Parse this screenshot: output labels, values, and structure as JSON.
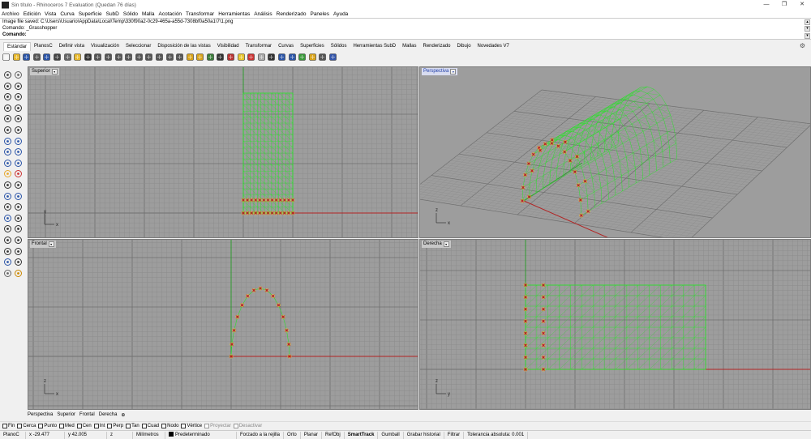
{
  "window": {
    "title": "Sin título - Rhinoceros 7 Evaluation (Quedan 76 días)",
    "min": "—",
    "restore": "❐",
    "close": "✕"
  },
  "menu": [
    "Archivo",
    "Edición",
    "Vista",
    "Curva",
    "Superficie",
    "SubD",
    "Sólido",
    "Malla",
    "Acotación",
    "Transformar",
    "Herramientas",
    "Análisis",
    "Renderizado",
    "Paneles",
    "Ayuda"
  ],
  "command": {
    "history": [
      "Image file saved: C:\\Users\\Usuario\\AppData\\Local\\Temp\\330f90a2-0c29-465a-a55d-7308bf0a50a1\\7\\1.png",
      "Comando: _Grasshopper"
    ],
    "prompt": "Comando:",
    "value": ""
  },
  "tabs": [
    "Estándar",
    "PlanosC",
    "Definir vista",
    "Visualización",
    "Seleccionar",
    "Disposición de las vistas",
    "Visibilidad",
    "Transformar",
    "Curvas",
    "Superficies",
    "Sólidos",
    "Herramientas SubD",
    "Mallas",
    "Renderizado",
    "Dibujo",
    "Novedades V7"
  ],
  "active_tab": "Estándar",
  "toolbar_icons": [
    "new-file-icon",
    "open-file-icon",
    "save-icon",
    "print-icon",
    "import-icon",
    "cut-icon",
    "copy-icon",
    "paste-icon",
    "undo-icon",
    "pan-icon",
    "rotate-view-icon",
    "zoom-window-icon",
    "zoom-dynamic-icon",
    "zoom-extents-icon",
    "zoom-selected-icon",
    "undo-view-icon",
    "four-viewports-icon",
    "select-all-icon",
    "hide-icon",
    "lock-icon",
    "layer-icon",
    "properties-icon",
    "osnap-icon",
    "lights-icon",
    "material-icon",
    "shaded-icon",
    "rendered-icon",
    "render-icon",
    "environment-icon",
    "grasshopper-icon",
    "sun-icon",
    "options-icon",
    "help-icon"
  ],
  "viewports": {
    "top": {
      "label": "Superior",
      "axis_y": "y",
      "axis_x": "x"
    },
    "perspective": {
      "label": "Perspectiva",
      "axis_y": "z",
      "axis_x": "x"
    },
    "front": {
      "label": "Frontal",
      "axis_y": "z",
      "axis_x": "x"
    },
    "right": {
      "label": "Derecha",
      "axis_y": "z",
      "axis_x": "y"
    }
  },
  "viewport_tabs": [
    "Perspectiva",
    "Superior",
    "Frontal",
    "Derecha"
  ],
  "viewport_tabs_add": "⊕",
  "osnaps": [
    {
      "label": "Fin",
      "checked": false
    },
    {
      "label": "Cerca",
      "checked": false
    },
    {
      "label": "Punto",
      "checked": false
    },
    {
      "label": "Med",
      "checked": false
    },
    {
      "label": "Cen",
      "checked": false
    },
    {
      "label": "Int",
      "checked": false
    },
    {
      "label": "Perp",
      "checked": false
    },
    {
      "label": "Tan",
      "checked": false
    },
    {
      "label": "Cuad",
      "checked": false
    },
    {
      "label": "Nodo",
      "checked": false
    },
    {
      "label": "Vértice",
      "checked": false
    },
    {
      "label": "Proyectar",
      "checked": false,
      "disabled": true
    },
    {
      "label": "Desactivar",
      "checked": false,
      "disabled": true
    }
  ],
  "status": {
    "cplane": "PlanoC",
    "x": "x -29.477",
    "y": "y 42.005",
    "z": "z",
    "units": "Milímetros",
    "layer": "Predeterminado",
    "items": [
      "Forzado a la rejilla",
      "Orto",
      "Planar",
      "RefObj",
      "SmartTrack",
      "Gumball",
      "Grabar historial",
      "Filtrar",
      "Tolerancia absoluta: 0.001"
    ],
    "bold_item": "SmartTrack"
  },
  "colors": {
    "viewport_bg": "#9d9d9d",
    "grid_minor": "#8d8d8d",
    "grid_major": "#6f6f6f",
    "x_axis": "#b22424",
    "y_axis": "#2e9a2e",
    "mesh": "#2de02d",
    "point": "#c8141a"
  }
}
